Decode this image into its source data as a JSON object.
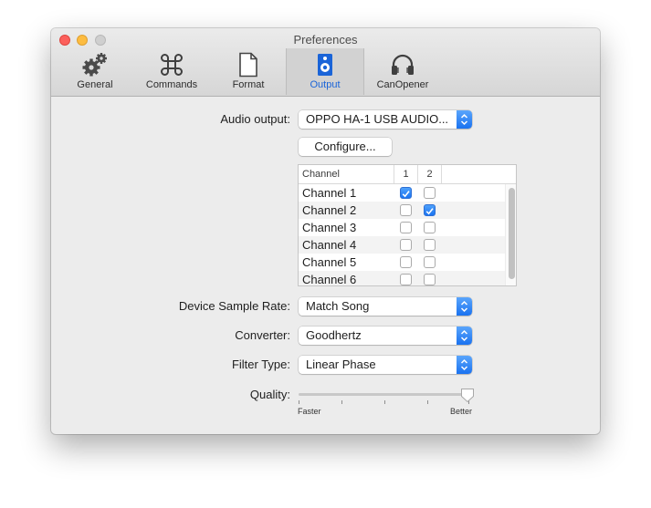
{
  "window": {
    "title": "Preferences"
  },
  "toolbar": {
    "tabs": [
      {
        "label": "General",
        "icon": "gears-icon"
      },
      {
        "label": "Commands",
        "icon": "command-key-icon"
      },
      {
        "label": "Format",
        "icon": "document-icon"
      },
      {
        "label": "Output",
        "icon": "speaker-icon",
        "selected": true
      },
      {
        "label": "CanOpener",
        "icon": "headphones-icon"
      }
    ]
  },
  "output": {
    "audio_output_label": "Audio output:",
    "audio_output_value": "OPPO HA-1 USB AUDIO...",
    "configure_label": "Configure...",
    "channel_table": {
      "headers": [
        "Channel",
        "1",
        "2"
      ],
      "rows": [
        {
          "name": "Channel 1",
          "ch1": true,
          "ch2": false
        },
        {
          "name": "Channel 2",
          "ch1": false,
          "ch2": true
        },
        {
          "name": "Channel 3",
          "ch1": false,
          "ch2": false
        },
        {
          "name": "Channel 4",
          "ch1": false,
          "ch2": false
        },
        {
          "name": "Channel 5",
          "ch1": false,
          "ch2": false
        },
        {
          "name": "Channel 6",
          "ch1": false,
          "ch2": false
        }
      ]
    },
    "sample_rate_label": "Device Sample Rate:",
    "sample_rate_value": "Match Song",
    "converter_label": "Converter:",
    "converter_value": "Goodhertz",
    "filter_type_label": "Filter Type:",
    "filter_type_value": "Linear Phase",
    "quality_label": "Quality:",
    "quality_min_label": "Faster",
    "quality_max_label": "Better",
    "quality_level": 1.0
  },
  "colors": {
    "accent": "#1a72f0",
    "selected_tab_text": "#1a64d8"
  }
}
